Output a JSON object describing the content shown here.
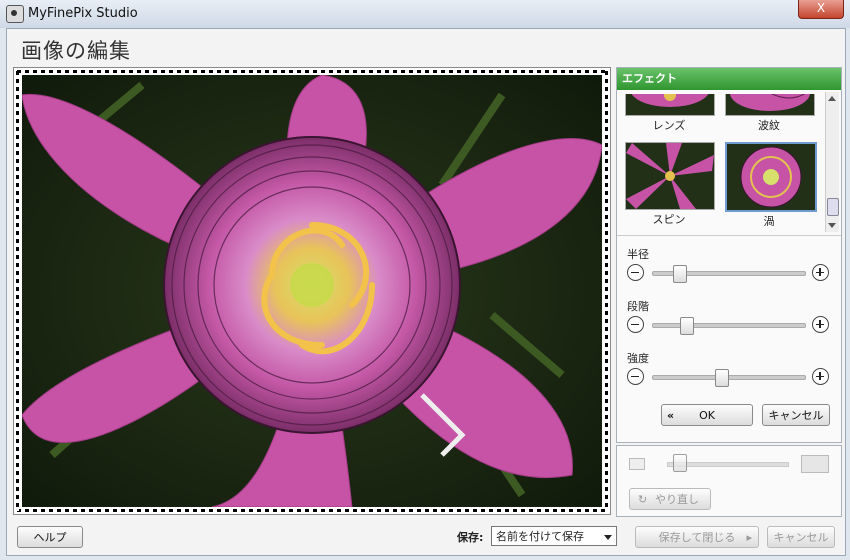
{
  "titlebar": {
    "app_title": "MyFinePix Studio",
    "close_label": "X"
  },
  "header": {
    "title": "画像の編集"
  },
  "effects_panel": {
    "title": "エフェクト",
    "items": [
      {
        "label": "レンズ"
      },
      {
        "label": "波紋"
      },
      {
        "label": "スピン"
      },
      {
        "label": "渦",
        "selected": true
      }
    ]
  },
  "controls": {
    "radius": {
      "label": "半径",
      "value": 0.15
    },
    "steps": {
      "label": "段階",
      "value": 0.2
    },
    "strength": {
      "label": "強度",
      "value": 0.45
    }
  },
  "buttons": {
    "ok": "OK",
    "cancel": "キャンセル",
    "redo": "やり直し",
    "help": "ヘルプ",
    "save_close": "保存して閉じる",
    "cancel_bottom": "キャンセル"
  },
  "zoom": {
    "value": 0.05
  },
  "save": {
    "label": "保存:",
    "selected": "名前を付けて保存"
  },
  "colors": {
    "accent": "#3a9e3a",
    "petal": "#cc4fa6"
  }
}
